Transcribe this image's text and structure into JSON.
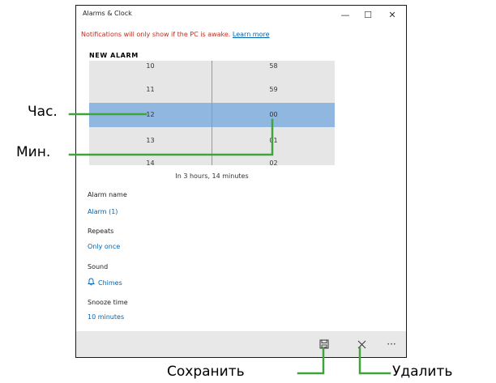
{
  "window": {
    "title": "Alarms & Clock",
    "controls": {
      "minimize": "—",
      "maximize": "☐",
      "close": "✕"
    }
  },
  "notification": {
    "text": "Notifications will only show if the PC is awake.",
    "link": "Learn more"
  },
  "heading": "NEW ALARM",
  "picker": {
    "hours": [
      "10",
      "11",
      "12",
      "13",
      "14"
    ],
    "minutes": [
      "58",
      "59",
      "00",
      "01",
      "02"
    ],
    "selected_hour": "12",
    "selected_minute": "00",
    "selection_color": "#8fb7e0"
  },
  "countdown": "In 3 hours, 14 minutes",
  "fields": {
    "alarm_name_label": "Alarm name",
    "alarm_name_value": "Alarm (1)",
    "repeats_label": "Repeats",
    "repeats_value": "Only once",
    "sound_label": "Sound",
    "sound_value": "Chimes",
    "sound_icon": "bell-icon",
    "snooze_label": "Snooze time",
    "snooze_value": "10 minutes"
  },
  "commandbar": {
    "save_icon": "save-icon",
    "delete_icon": "close-icon",
    "more_label": "···"
  },
  "callouts": {
    "hour": "Час.",
    "minute": "Мин.",
    "save": "Сохранить",
    "delete": "Удалить",
    "line_color": "#3fa53a"
  },
  "colors": {
    "link": "#0063b1",
    "warning": "#c42b1c",
    "picker_bg": "#e6e6e6",
    "cmdbar_bg": "#e8e8e8"
  }
}
